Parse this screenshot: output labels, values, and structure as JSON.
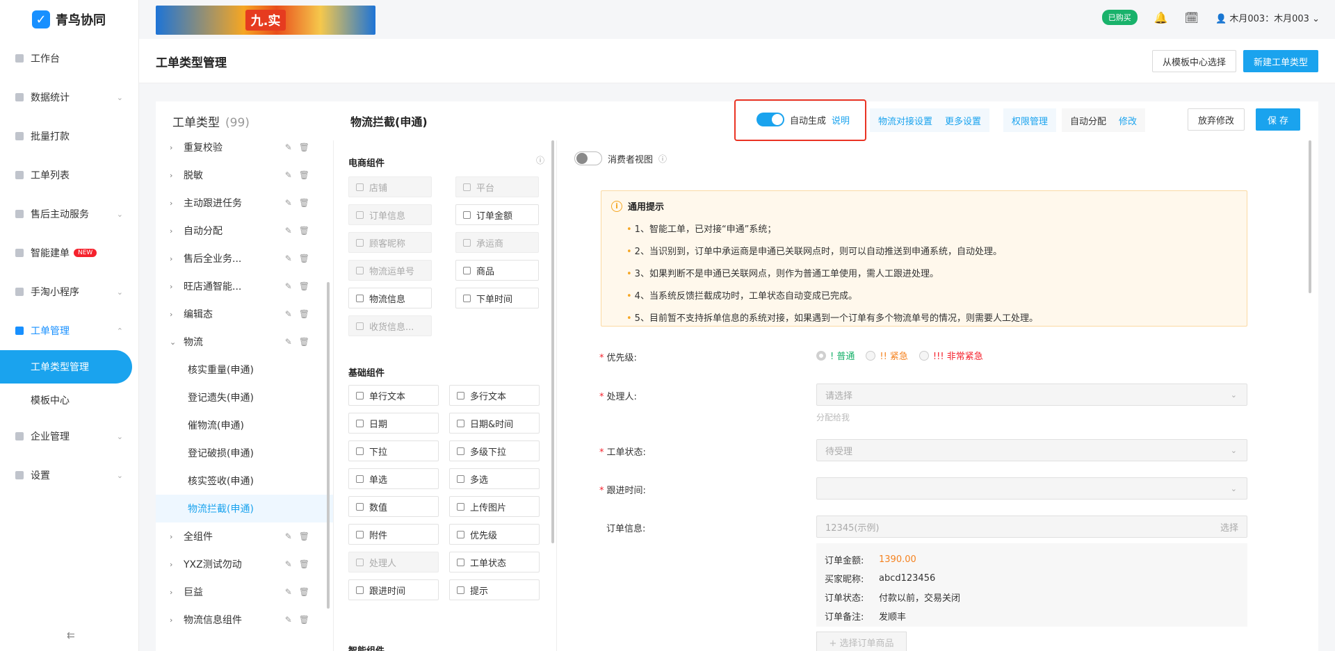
{
  "app": {
    "logo_text": "青鸟协同"
  },
  "sidebar": {
    "items": [
      {
        "label": "工作台"
      },
      {
        "label": "数据统计"
      },
      {
        "label": "批量打款"
      },
      {
        "label": "工单列表"
      },
      {
        "label": "售后主动服务"
      },
      {
        "label": "智能建单",
        "badge": "NEW"
      },
      {
        "label": "手淘小程序"
      },
      {
        "label": "工单管理"
      },
      {
        "label": "企业管理"
      },
      {
        "label": "设置"
      }
    ],
    "subitems": [
      {
        "label": "工单类型管理"
      },
      {
        "label": "模板中心"
      }
    ],
    "collapse_icon": "⇇"
  },
  "topbar": {
    "banner_text": "九.实",
    "bought": "已购买",
    "user": "木月003：木月003"
  },
  "titlebar": {
    "title": "工单类型管理",
    "template_btn": "从模板中心选择",
    "new_btn": "新建工单类型"
  },
  "panel": {
    "types_label": "工单类型",
    "types_count": "(99)",
    "current_name": "物流拦截(申通)",
    "auto_gen_label": "自动生成",
    "auto_gen_link": "说明",
    "logistics_btn": "物流对接设置",
    "more_btn": "更多设置",
    "perm_btn": "权限管理",
    "auto_assign": "自动分配",
    "auto_assign_edit": "修改",
    "discard_btn": "放弃修改",
    "save_btn": "保 存"
  },
  "tree": {
    "items": [
      "重复校验",
      "脱敏",
      "主动跟进任务",
      "自动分配",
      "售后全业务...",
      "旺店通智能...",
      "编辑态"
    ],
    "expanded": "物流",
    "children": [
      "核实重量(申通)",
      "登记遗失(申通)",
      "催物流(申通)",
      "登记破损(申通)",
      "核实签收(申通)",
      "物流拦截(申通)"
    ],
    "after": [
      "全组件",
      "YXZ测试勿动",
      "巨益",
      "物流信息组件"
    ]
  },
  "components": {
    "ecom_title": "电商组件",
    "ecom": [
      {
        "label": "店铺",
        "disabled": true
      },
      {
        "label": "平台",
        "disabled": true
      },
      {
        "label": "订单信息",
        "disabled": true
      },
      {
        "label": "订单金额",
        "disabled": false
      },
      {
        "label": "顾客昵称",
        "disabled": true
      },
      {
        "label": "承运商",
        "disabled": true
      },
      {
        "label": "物流运单号",
        "disabled": true
      },
      {
        "label": "商品",
        "disabled": false
      },
      {
        "label": "物流信息",
        "disabled": false
      },
      {
        "label": "下单时间",
        "disabled": false
      },
      {
        "label": "收货信息...",
        "disabled": true
      }
    ],
    "basic_title": "基础组件",
    "basic": [
      {
        "label": "单行文本",
        "disabled": false
      },
      {
        "label": "多行文本",
        "disabled": false
      },
      {
        "label": "日期",
        "disabled": false
      },
      {
        "label": "日期&时间",
        "disabled": false
      },
      {
        "label": "下拉",
        "disabled": false
      },
      {
        "label": "多级下拉",
        "disabled": false
      },
      {
        "label": "单选",
        "disabled": false
      },
      {
        "label": "多选",
        "disabled": false
      },
      {
        "label": "数值",
        "disabled": false
      },
      {
        "label": "上传图片",
        "disabled": false
      },
      {
        "label": "附件",
        "disabled": false
      },
      {
        "label": "优先级",
        "disabled": false
      },
      {
        "label": "处理人",
        "disabled": true
      },
      {
        "label": "工单状态",
        "disabled": false
      },
      {
        "label": "跟进时间",
        "disabled": false
      },
      {
        "label": "提示",
        "disabled": false
      }
    ],
    "smart_title": "智能组件"
  },
  "form": {
    "consumer_view": "消费者视图",
    "tip_title": "通用提示",
    "tips": [
      "1、智能工单，已对接“申通”系统；",
      "2、当识别到，订单中承运商是申通已关联网点时，则可以自动推送到申通系统，自动处理。",
      "3、如果判断不是申通已关联网点，则作为普通工单使用，需人工跟进处理。",
      "4、当系统反馈拦截成功时，工单状态自动变成已完成。",
      "5、目前暂不支持拆单信息的系统对接，如果遇到一个订单有多个物流单号的情况，则需要人工处理。"
    ],
    "priority_label": "优先级:",
    "priority_options": [
      {
        "label": "! 普通",
        "color": "#19b26b"
      },
      {
        "label": "!! 紧急",
        "color": "#f5821f"
      },
      {
        "label": "!!! 非常紧急",
        "color": "#f5222d"
      }
    ],
    "handler_label": "处理人:",
    "handler_placeholder": "请选择",
    "assign_me": "分配给我",
    "status_label": "工单状态:",
    "status_value": "待受理",
    "follow_label": "跟进时间:",
    "order_label": "订单信息:",
    "order_value": "12345(示例)",
    "order_select": "选择",
    "order_details": [
      {
        "k": "订单金额:",
        "v": "1390.00"
      },
      {
        "k": "买家昵称:",
        "v": "abcd123456"
      },
      {
        "k": "订单状态:",
        "v": "付款以前，交易关闭"
      },
      {
        "k": "订单备注:",
        "v": "发顺丰"
      }
    ],
    "add_product": "+ 选择订单商品"
  }
}
